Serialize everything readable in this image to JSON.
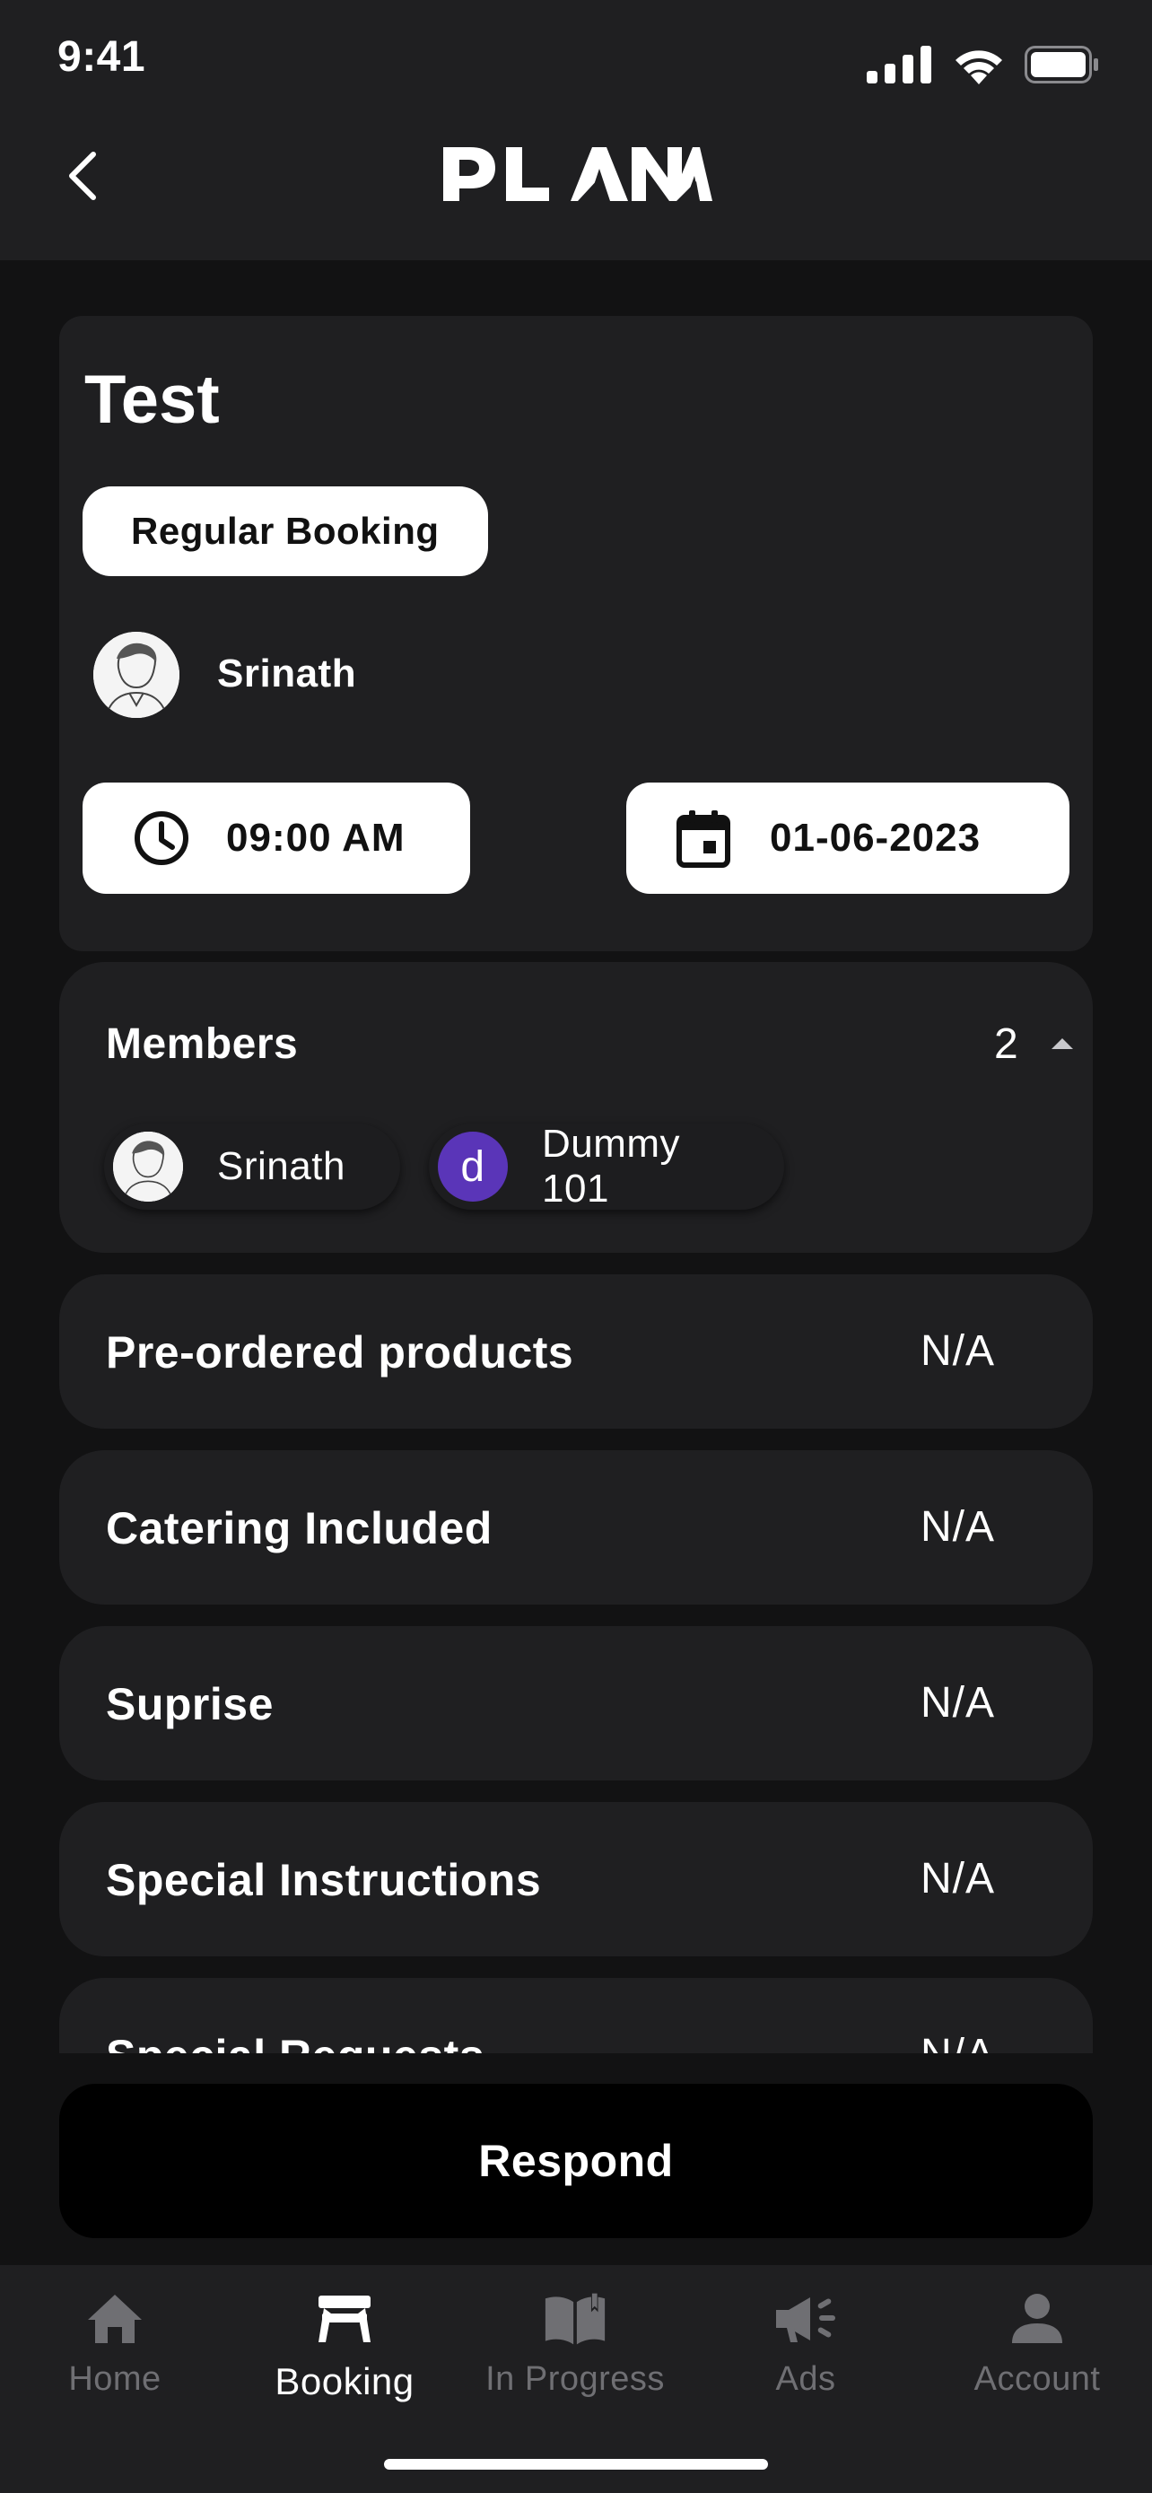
{
  "status_bar": {
    "time": "9:41"
  },
  "header": {
    "logo_text": "PLANA"
  },
  "booking": {
    "title": "Test",
    "type_label": "Regular Booking",
    "host_name": "Srinath",
    "time": "09:00 AM",
    "date": "01-06-2023"
  },
  "members": {
    "label": "Members",
    "count": "2",
    "list": [
      {
        "name": "Srinath",
        "avatar": "photo"
      },
      {
        "name": "Dummy 101",
        "initial": "d"
      }
    ]
  },
  "details": [
    {
      "label": "Pre-ordered products",
      "value": "N/A"
    },
    {
      "label": "Catering Included",
      "value": "N/A"
    },
    {
      "label": "Suprise",
      "value": "N/A"
    },
    {
      "label": "Special Instructions",
      "value": "N/A"
    },
    {
      "label": "Special Requests",
      "value": "N/A"
    }
  ],
  "respond_label": "Respond",
  "tabs": [
    {
      "label": "Home",
      "icon": "home-icon",
      "active": false
    },
    {
      "label": "Booking",
      "icon": "table-icon",
      "active": true
    },
    {
      "label": "In Progress",
      "icon": "book-icon",
      "active": false
    },
    {
      "label": "Ads",
      "icon": "megaphone-icon",
      "active": false
    },
    {
      "label": "Account",
      "icon": "person-icon",
      "active": false
    }
  ],
  "colors": {
    "background": "#121213",
    "card": "#1f1f21",
    "accent_avatar": "#5a35b8",
    "inactive_tab": "#6f6f73"
  }
}
